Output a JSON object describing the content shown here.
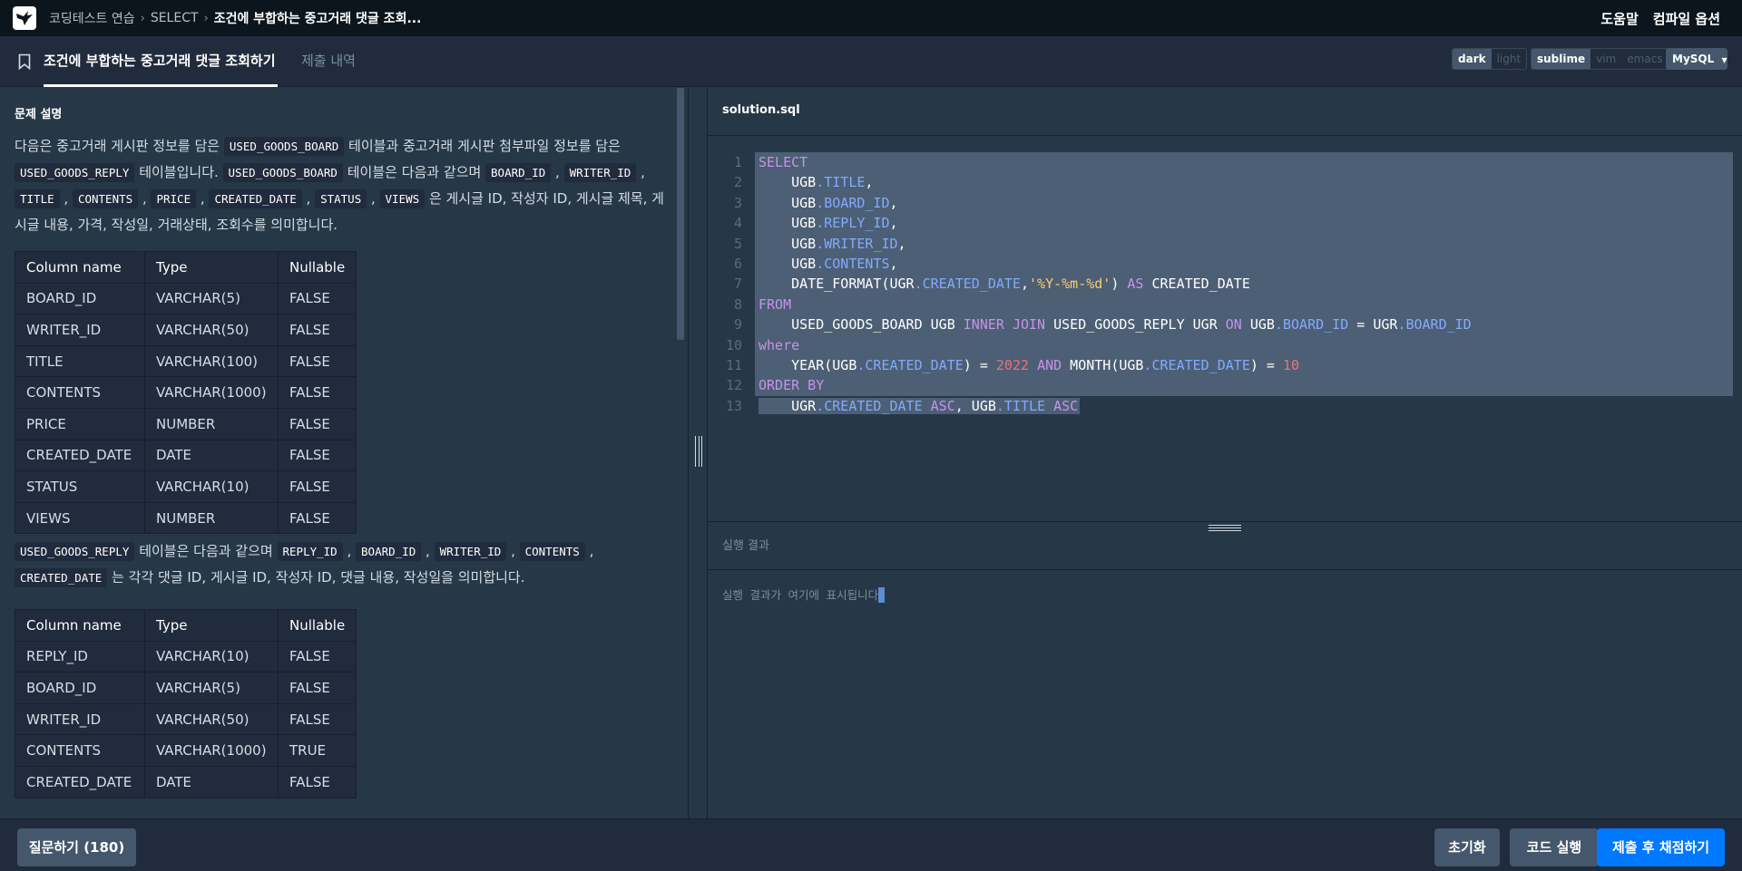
{
  "breadcrumb": {
    "items": [
      "코딩테스트 연습",
      "SELECT",
      "조건에 부합하는 중고거래 댓글 조회..."
    ]
  },
  "top_menu": {
    "help": "도움말",
    "compile_options": "컴파일 옵션"
  },
  "tabs": {
    "problem": "조건에 부합하는 중고거래 댓글 조회하기",
    "submissions": "제출 내역"
  },
  "editor_options": {
    "theme": {
      "dark": "dark",
      "light": "light",
      "selected": "dark"
    },
    "keymap": {
      "sublime": "sublime",
      "vim": "vim",
      "emacs": "emacs",
      "selected": "sublime"
    },
    "language": "MySQL"
  },
  "problem": {
    "section_title": "문제 설명",
    "para1": {
      "t1": "다음은 중고거래 게시판 정보를 담은 ",
      "c1": "USED_GOODS_BOARD",
      "t2": " 테이블과 중고거래 게시판 첨부파일 정보를 담은 ",
      "c2": "USED_GOODS_REPLY",
      "t3": " 테이블입니다. ",
      "c3": "USED_GOODS_BOARD",
      "t4": " 테이블은 다음과 같으며 ",
      "c4": "BOARD_ID",
      "t5": " , ",
      "c5": "WRITER_ID",
      "t6": " , ",
      "c6": "TITLE",
      "t7": " , ",
      "c7": "CONTENTS",
      "t8": " , ",
      "c8": "PRICE",
      "t9": " , ",
      "c9": "CREATED_DATE",
      "t10": " , ",
      "c10": "STATUS",
      "t11": " , ",
      "c11": "VIEWS",
      "t12": " 은 게시글 ID, 작성자 ID, 게시글 제목, 게시글 내용, 가격, 작성일, 거래상태, 조회수를 의미합니다."
    },
    "table1": {
      "headers": [
        "Column name",
        "Type",
        "Nullable"
      ],
      "rows": [
        [
          "BOARD_ID",
          "VARCHAR(5)",
          "FALSE"
        ],
        [
          "WRITER_ID",
          "VARCHAR(50)",
          "FALSE"
        ],
        [
          "TITLE",
          "VARCHAR(100)",
          "FALSE"
        ],
        [
          "CONTENTS",
          "VARCHAR(1000)",
          "FALSE"
        ],
        [
          "PRICE",
          "NUMBER",
          "FALSE"
        ],
        [
          "CREATED_DATE",
          "DATE",
          "FALSE"
        ],
        [
          "STATUS",
          "VARCHAR(10)",
          "FALSE"
        ],
        [
          "VIEWS",
          "NUMBER",
          "FALSE"
        ]
      ]
    },
    "para2": {
      "c1": "USED_GOODS_REPLY",
      "t1": " 테이블은 다음과 같으며 ",
      "c2": "REPLY_ID",
      "t2": " , ",
      "c3": "BOARD_ID",
      "t3": " , ",
      "c4": "WRITER_ID",
      "t4": " , ",
      "c5": "CONTENTS",
      "t5": " , ",
      "c6": "CREATED_DATE",
      "t6": " 는 각각 댓글 ID, 게시글 ID, 작성자 ID, 댓글 내용, 작성일을 의미합니다."
    },
    "table2": {
      "headers": [
        "Column name",
        "Type",
        "Nullable"
      ],
      "rows": [
        [
          "REPLY_ID",
          "VARCHAR(10)",
          "FALSE"
        ],
        [
          "BOARD_ID",
          "VARCHAR(5)",
          "FALSE"
        ],
        [
          "WRITER_ID",
          "VARCHAR(50)",
          "FALSE"
        ],
        [
          "CONTENTS",
          "VARCHAR(1000)",
          "TRUE"
        ],
        [
          "CREATED_DATE",
          "DATE",
          "FALSE"
        ]
      ]
    }
  },
  "editor": {
    "filename": "solution.sql",
    "line_numbers": [
      "1",
      "2",
      "3",
      "4",
      "5",
      "6",
      "7",
      "8",
      "9",
      "10",
      "11",
      "12",
      "13"
    ],
    "code": {
      "l1": {
        "a": "SELECT"
      },
      "l2": {
        "a": "    UGB",
        "b": ".TITLE",
        "c": ","
      },
      "l3": {
        "a": "    UGB",
        "b": ".BOARD_ID",
        "c": ","
      },
      "l4": {
        "a": "    UGB",
        "b": ".REPLY_ID",
        "c": ","
      },
      "l5": {
        "a": "    UGB",
        "b": ".WRITER_ID",
        "c": ","
      },
      "l6": {
        "a": "    UGB",
        "b": ".CONTENTS",
        "c": ","
      },
      "l7": {
        "a": "    DATE_FORMAT(UGR",
        "b": ".CREATED_DATE",
        "c": ",",
        "d": "'%Y-%m-%d'",
        "e": ") ",
        "f": "AS",
        "g": " CREATED_DATE"
      },
      "l8": {
        "a": "FROM"
      },
      "l9": {
        "a": "    USED_GOODS_BOARD UGB ",
        "b": "INNER JOIN",
        "c": " USED_GOODS_REPLY UGR ",
        "d": "ON",
        "e": " UGB",
        "f": ".BOARD_ID",
        "g": " = UGR",
        "h": ".BOARD_ID"
      },
      "l10": {
        "a": "where"
      },
      "l11": {
        "a": "    YEAR(UGB",
        "b": ".CREATED_DATE",
        "c": ") = ",
        "d": "2022",
        "e": " ",
        "f": "AND",
        "g": " MONTH(UGB",
        "h": ".CREATED_DATE",
        "i": ") = ",
        "j": "10"
      },
      "l12": {
        "a": "ORDER BY"
      },
      "l13": {
        "a": "    UGR",
        "b": ".CREATED_DATE",
        "c": " ",
        "d": "ASC",
        "e": ", UGB",
        "f": ".TITLE",
        "g": " ",
        "h": "ASC"
      }
    }
  },
  "result": {
    "title": "실행 결과",
    "placeholder": "실행 결과가 여기에 표시됩니다"
  },
  "buttons": {
    "ask": "질문하기 (180)",
    "reset": "초기화",
    "run": "코드 실행",
    "submit": "제출 후 채점하기"
  },
  "colors": {
    "accent": "#0078ff",
    "background": "#263747",
    "keyword": "#c792ea",
    "field": "#82aaff",
    "string": "#ffcb6b",
    "number": "#f07178"
  }
}
